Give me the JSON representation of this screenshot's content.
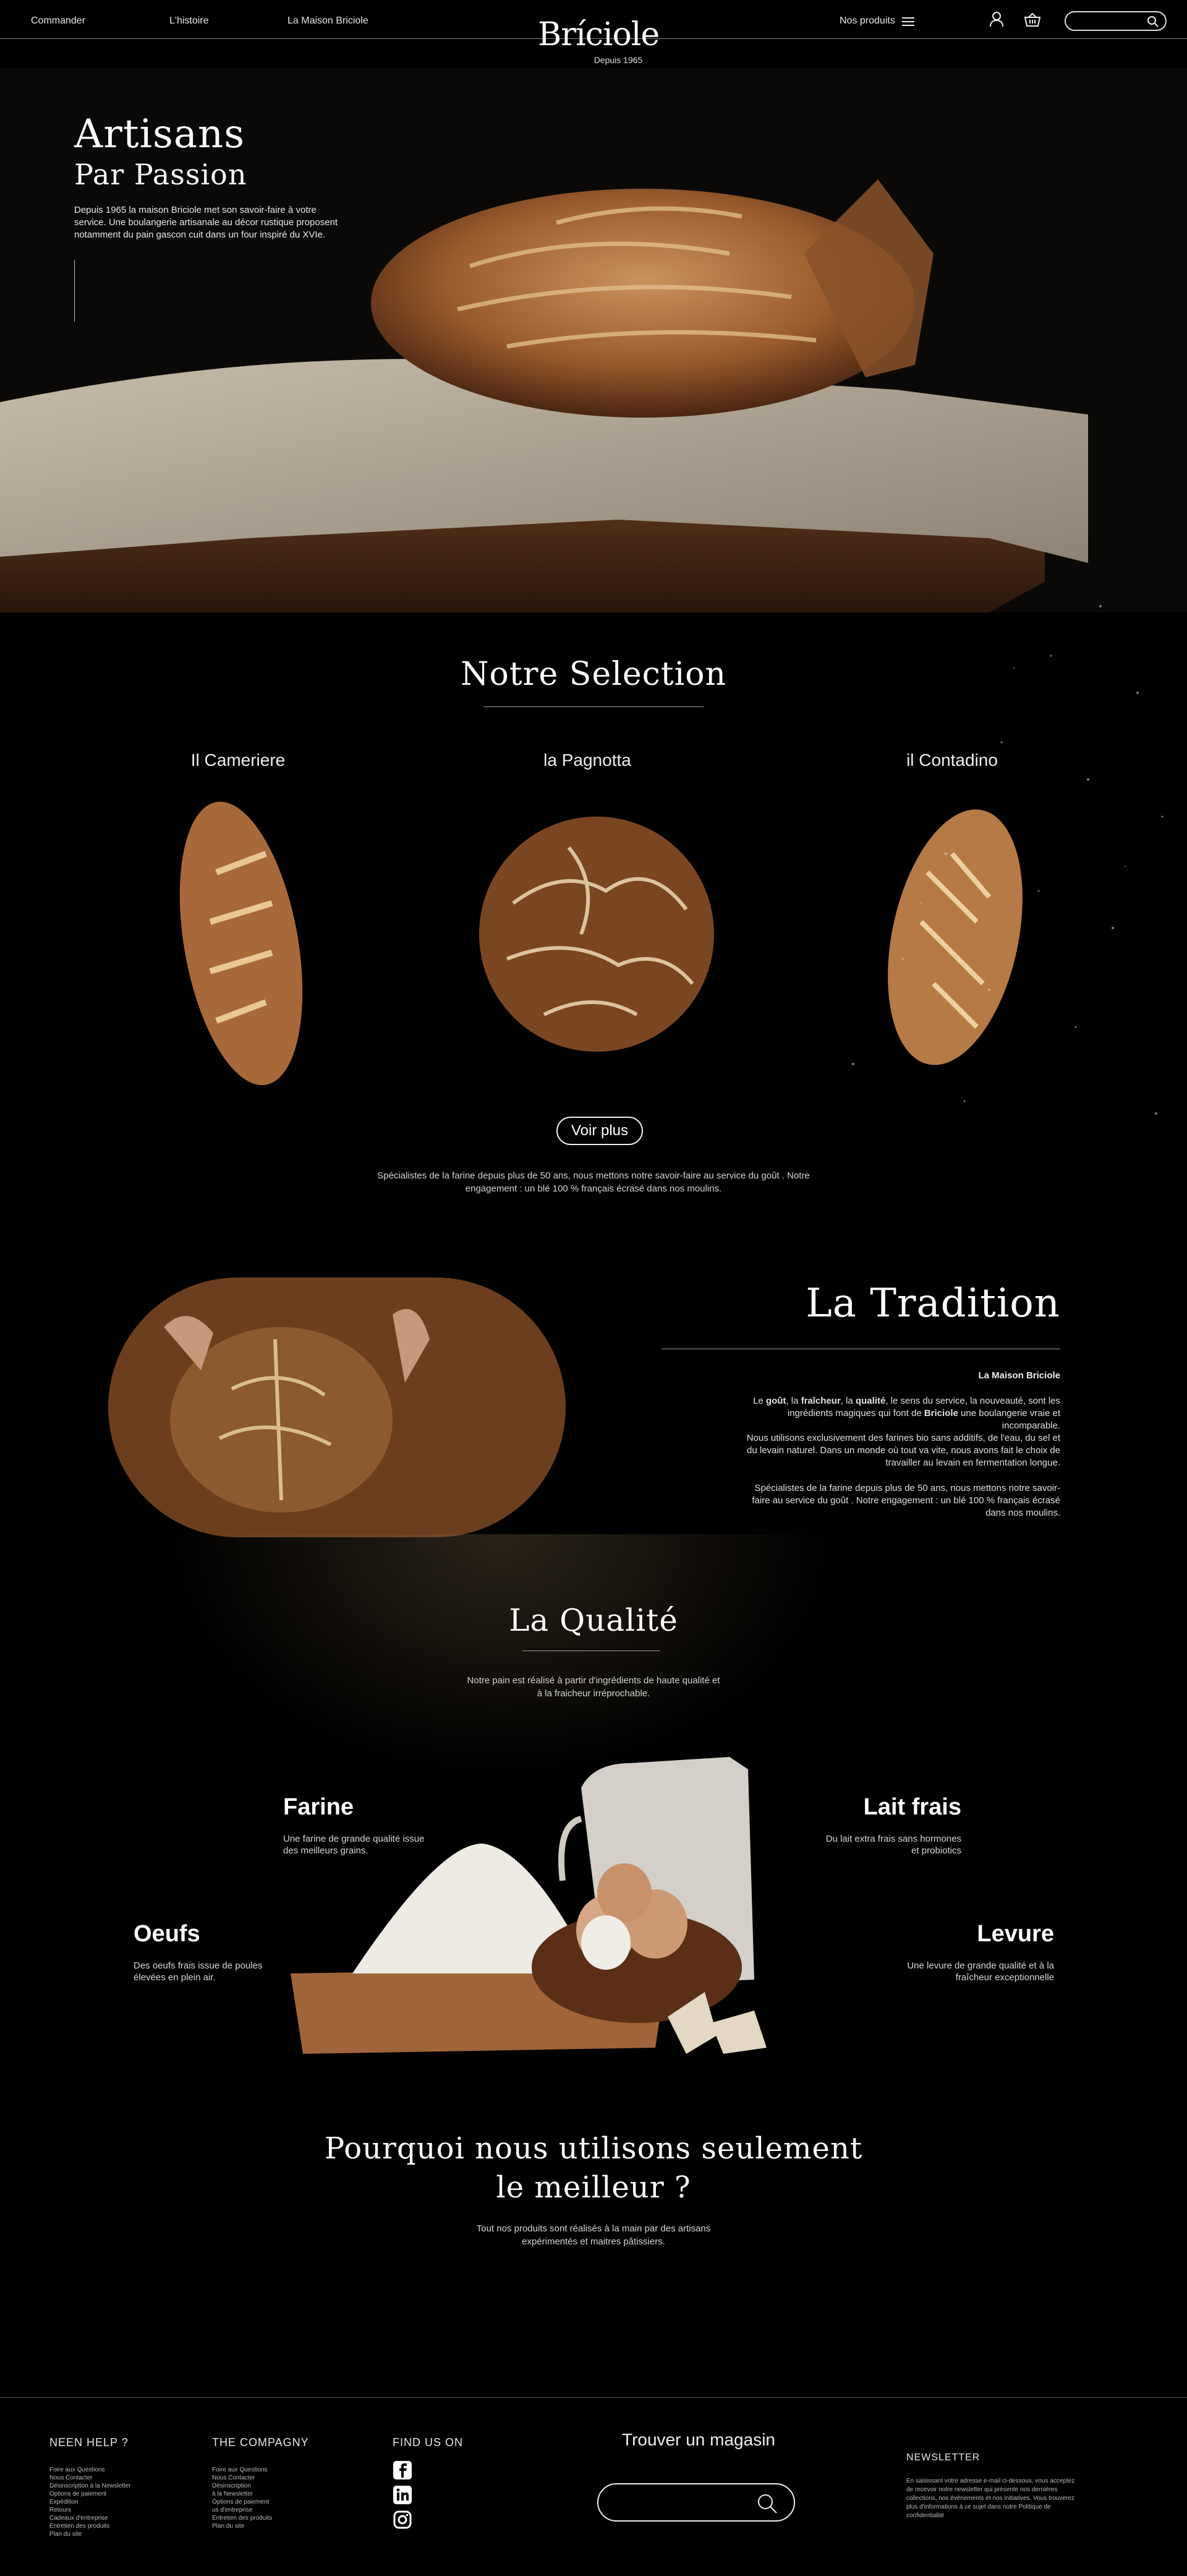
{
  "header": {
    "nav_left": [
      "Commander",
      "L'histoire",
      "La Maison Briciole"
    ],
    "logo": "Bríciole",
    "logo_sub": "Depuis 1965",
    "products_label": "Nos produits"
  },
  "hero": {
    "title_line1": "Artisans",
    "title_line2": "Par Passion",
    "text": "Depuis 1965 la maison Briciole met son savoir-faire à votre service. Une boulangerie artisanale au décor rustique proposent notamment du pain gascon cuit dans un four inspiré du XVIe."
  },
  "selection": {
    "title": "Notre Selection",
    "breads": [
      "Il Cameriere",
      "la  Pagnotta",
      "il Contadino"
    ],
    "button": "Voir plus",
    "text": "Spécialistes de la farine depuis plus de 50 ans, nous mettons notre savoir-faire au service du goût . Notre engagement : un blé 100 % français écrasé dans nos moulins."
  },
  "tradition": {
    "title": "La Tradition",
    "subtitle": "La Maison Briciole",
    "p1_a": "Le ",
    "p1_b": "goût",
    "p1_c": ", la ",
    "p1_d": "fraîcheur",
    "p1_e": ", la ",
    "p1_f": "qualité",
    "p1_g": ", le sens du service, la nouveauté, sont les ingrédients magiques qui font de ",
    "p1_h": "Briciole",
    "p1_i": " une boulangerie vraie et incomparable.",
    "p2": "Nous utilisons exclusivement des farines bio sans additifs, de l'eau, du sel et du levain naturel. Dans un monde où tout va vite, nous avons fait le choix de travailler au levain en fermentation longue.",
    "p3": "Spécialistes de la farine depuis plus de 50 ans, nous mettons notre savoir-faire au service du goût . Notre engagement : un blé 100 % français écrasé dans nos moulins."
  },
  "qualite": {
    "title": "La Qualité",
    "text": "Notre pain est réalisé à partir d'ingrédients de haute qualité et à la fraicheur irréprochable.",
    "items": [
      {
        "title": "Farine",
        "desc": "Une farine de grande qualité issue des meilleurs grains."
      },
      {
        "title": "Lait frais",
        "desc": "Du lait extra frais sans hormones et probiotics"
      },
      {
        "title": "Oeufs",
        "desc": "Des oeufs frais issue de poules élevées en plein air."
      },
      {
        "title": "Levure",
        "desc": "Une levure de grande qualité et à la fraîcheur exceptionnelle"
      }
    ]
  },
  "pourquoi": {
    "title_line1": "Pourquoi nous utilisons seulement",
    "title_line2": "le meilleur ?",
    "text": "Tout nos produits sont réalisés à la main par des artisans expérimentés et maitres pâtissiers."
  },
  "footer": {
    "help_title": "NEEN HELP ?",
    "help_links": [
      "Foire aux Questions",
      "Nous Contacter",
      "Désinscription à la Newsletter",
      "Options de paiement",
      "Expédition",
      "Retours",
      "Cadeaux d'entreprise",
      "Entretien des produits",
      "Plan du site"
    ],
    "company_title": "THE COMPAGNY",
    "company_links": [
      "Foire aux Questions",
      "Nous Contacter",
      "Désinscription",
      "à la Newsletter",
      "Options de paiement",
      "us d'entreprise",
      "Entretien des produits",
      "Plan du site"
    ],
    "find_title": "FIND US ON",
    "store_title": "Trouver un magasin",
    "newsletter_title": "NEWSLETTER",
    "newsletter_text": "En saisissant votre adresse e-mail ci-dessous, vous acceptez de recevoir notre newsletter qui présente nos dernières collections, nos évènements et nos initiatives. Vous trouverez plus d'informations à ce sujet dans notre Politique de confidentialité"
  },
  "colors": {
    "background": "#000000",
    "text": "#ffffff",
    "bread": "#a8683a",
    "wood": "#5a3418"
  },
  "icons": [
    "menu-icon",
    "user-icon",
    "basket-icon",
    "search-icon",
    "facebook-icon",
    "linkedin-icon",
    "instagram-icon"
  ]
}
